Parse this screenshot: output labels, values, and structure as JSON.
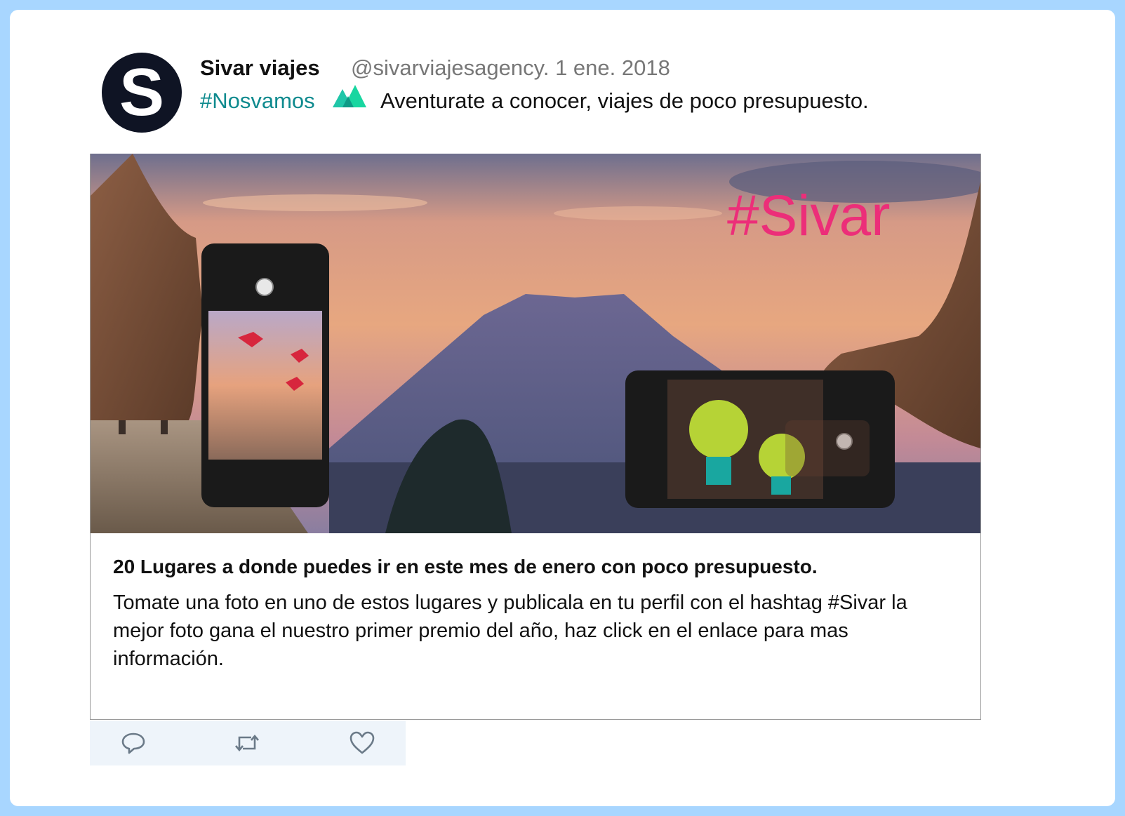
{
  "tweet": {
    "avatar_letter": "S",
    "name": "Sivar viajes",
    "handle_date": "@sivarviajesagency. 1 ene. 2018",
    "hashtag": "#Nosvamos",
    "text": "Aventurate a conocer, viajes de poco presupuesto."
  },
  "card": {
    "overlay_hashtag": "#Sivar",
    "title": "20 Lugares a donde puedes ir en este mes de enero con poco presupuesto.",
    "description": "Tomate una foto en uno de estos lugares y publicala en tu perfil con el hashtag #Sivar la mejor foto gana el nuestro primer premio del año, haz click en el enlace para mas información."
  },
  "icons": {
    "reply": "reply-icon",
    "retweet": "retweet-icon",
    "like": "heart-icon",
    "mountain": "mountain-icon"
  },
  "colors": {
    "frame_border": "#a8d6ff",
    "hashtag": "#0e8a8e",
    "overlay_hashtag": "#ec2e79",
    "avatar_bg": "#0f1424",
    "handle": "#777777",
    "actions_bg": "#eef4fa"
  }
}
